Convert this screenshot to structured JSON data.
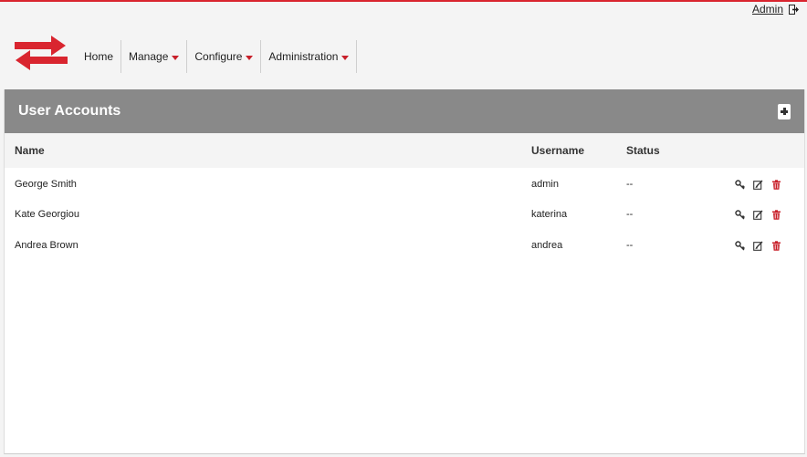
{
  "header": {
    "user_link": "Admin",
    "logout_icon": "logout-icon"
  },
  "nav": {
    "items": [
      {
        "label": "Home",
        "has_dropdown": false
      },
      {
        "label": "Manage",
        "has_dropdown": true
      },
      {
        "label": "Configure",
        "has_dropdown": true
      },
      {
        "label": "Administration",
        "has_dropdown": true
      }
    ]
  },
  "panel": {
    "title": "User Accounts",
    "add_icon": "plus-icon"
  },
  "table": {
    "columns": [
      "Name",
      "Username",
      "Status",
      ""
    ],
    "rows": [
      {
        "name": "George Smith",
        "username": "admin",
        "status": "--"
      },
      {
        "name": "Kate Georgiou",
        "username": "katerina",
        "status": "--"
      },
      {
        "name": "Andrea Brown",
        "username": "andrea",
        "status": "--"
      }
    ],
    "row_actions": [
      "key-icon",
      "edit-icon",
      "delete-icon"
    ]
  },
  "colors": {
    "accent": "#d9252f",
    "header_bar": "#898989",
    "background": "#f4f4f4"
  }
}
